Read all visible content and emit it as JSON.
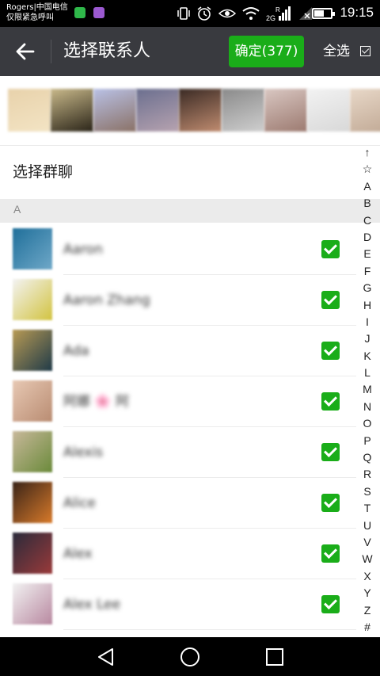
{
  "status_bar": {
    "carrier_line1": "Rogers|中国电信",
    "carrier_line2": "仅限紧急呼叫",
    "network_label": "2G",
    "roaming_label": "R",
    "battery_level": 0.55,
    "time": "19:15"
  },
  "header": {
    "title": "选择联系人",
    "confirm_label": "确定(377)",
    "select_all_label": "全选",
    "select_all_checked": true
  },
  "selected_strip": {
    "thumbnails": [
      {
        "color_a": "#e8d2ab",
        "color_b": "#f3e4c4"
      },
      {
        "color_a": "#c9b98a",
        "color_b": "#2a2418"
      },
      {
        "color_a": "#b9c1e6",
        "color_b": "#8a7166"
      },
      {
        "color_a": "#6b6f8f",
        "color_b": "#b7a3b0"
      },
      {
        "color_a": "#3a2a24",
        "color_b": "#c08c70"
      },
      {
        "color_a": "#8a8a8a",
        "color_b": "#cfcfcf"
      },
      {
        "color_a": "#d9c7c2",
        "color_b": "#9c7a70"
      },
      {
        "color_a": "#f2f2f2",
        "color_b": "#d8d8d8"
      },
      {
        "color_a": "#e8d8c8",
        "color_b": "#c0a894"
      }
    ]
  },
  "group_chat_label": "选择群聊",
  "section": {
    "letter": "A"
  },
  "contacts": [
    {
      "name": "Aaron",
      "checked": true,
      "avatar_a": "#1f6f9a",
      "avatar_b": "#6fa8c8"
    },
    {
      "name": "Aaron Zhang",
      "checked": true,
      "avatar_a": "#f3f3f3",
      "avatar_b": "#d2c340"
    },
    {
      "name": "Ada",
      "checked": true,
      "avatar_a": "#b89a54",
      "avatar_b": "#1f3a48"
    },
    {
      "name": "阿娜 🌸 阿",
      "checked": true,
      "avatar_a": "#e7c8b3",
      "avatar_b": "#b98c72"
    },
    {
      "name": "Alexis",
      "checked": true,
      "avatar_a": "#c8b89a",
      "avatar_b": "#6a8a3a"
    },
    {
      "name": "Alice",
      "checked": true,
      "avatar_a": "#3a2418",
      "avatar_b": "#d87a2a"
    },
    {
      "name": "Alex",
      "checked": true,
      "avatar_a": "#2a2a3a",
      "avatar_b": "#9a3a3a"
    },
    {
      "name": "Alex Lee",
      "checked": true,
      "avatar_a": "#f2f2f2",
      "avatar_b": "#b888a0"
    }
  ],
  "index_items": [
    "↑",
    "☆",
    "A",
    "B",
    "C",
    "D",
    "E",
    "F",
    "G",
    "H",
    "I",
    "J",
    "K",
    "L",
    "M",
    "N",
    "O",
    "P",
    "Q",
    "R",
    "S",
    "T",
    "U",
    "V",
    "W",
    "X",
    "Y",
    "Z",
    "#"
  ],
  "colors": {
    "header_bg": "#393a3f",
    "accent_green": "#1aad19",
    "section_bg": "#ebebeb"
  }
}
